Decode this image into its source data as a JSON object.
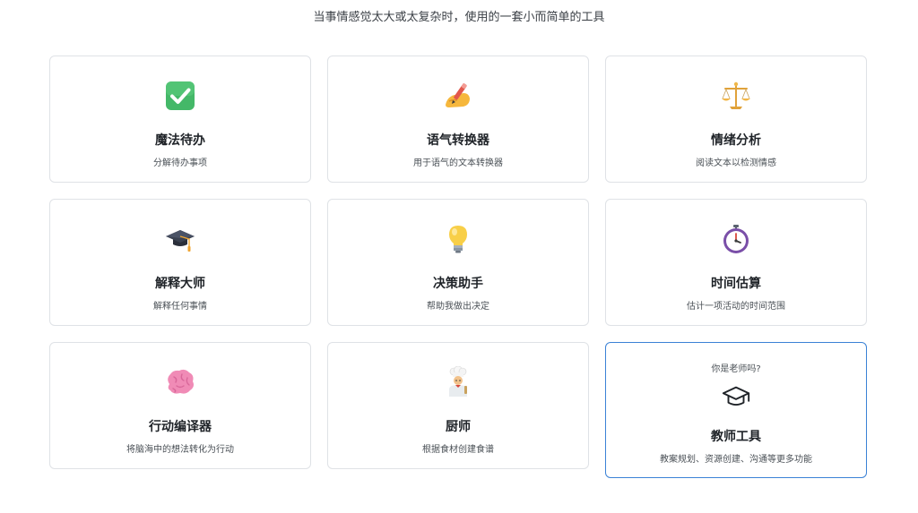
{
  "header": {
    "subtitle": "当事情感觉太大或太复杂时，使用的一套小而简单的工具"
  },
  "tools": [
    {
      "title": "魔法待办",
      "desc": "分解待办事项",
      "icon": "checkmark-icon"
    },
    {
      "title": "语气转换器",
      "desc": "用于语气的文本转换器",
      "icon": "writing-hand-icon"
    },
    {
      "title": "情绪分析",
      "desc": "阅读文本以检测情感",
      "icon": "balance-scale-icon"
    },
    {
      "title": "解释大师",
      "desc": "解释任何事情",
      "icon": "graduation-cap-icon"
    },
    {
      "title": "决策助手",
      "desc": "帮助我做出决定",
      "icon": "light-bulb-icon"
    },
    {
      "title": "时间估算",
      "desc": "估计一项活动的时间范围",
      "icon": "stopwatch-icon"
    },
    {
      "title": "行动编译器",
      "desc": "将脑海中的想法转化为行动",
      "icon": "brain-icon"
    },
    {
      "title": "厨师",
      "desc": "根据食材创建食谱",
      "icon": "chef-icon"
    }
  ],
  "teacher_card": {
    "question": "你是老师吗?",
    "title": "教师工具",
    "desc": "教案规划、资源创建、沟通等更多功能",
    "icon": "mortarboard-outline-icon"
  },
  "colors": {
    "featured_border": "#3b82d6",
    "card_border": "#dfe2e6"
  }
}
